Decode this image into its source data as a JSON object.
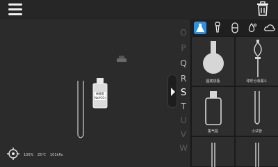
{
  "header": {
    "menu_icon": "hamburger-menu-icon",
    "trash_icon": "trash-icon"
  },
  "letter_rail": {
    "letters": [
      "O",
      "P",
      "Q",
      "R",
      "S",
      "T",
      "U",
      "V",
      "W"
    ],
    "active": "S"
  },
  "bench": {
    "bottle_label_line1": "碳酸氢",
    "bottle_label_line2": "NaHCO₃"
  },
  "panel": {
    "tabs": [
      {
        "name": "flask-tab",
        "icon": "flask-icon",
        "active": true
      },
      {
        "name": "dropper-tab",
        "icon": "dropper-icon",
        "active": false
      },
      {
        "name": "capsule-tab",
        "icon": "capsule-icon",
        "active": false
      },
      {
        "name": "drops-tab",
        "icon": "drops-icon",
        "active": false
      },
      {
        "name": "cloud-tab",
        "icon": "cloud-icon",
        "active": false
      }
    ],
    "items": [
      {
        "label": "圆底烧瓶"
      },
      {
        "label": "球形分液漏斗"
      },
      {
        "label": "集气瓶"
      },
      {
        "label": "小试管"
      }
    ]
  },
  "status": {
    "humidity": "100%",
    "temperature": "25℃",
    "pressure": "101kPa"
  },
  "colors": {
    "accent": "#2f8fe0",
    "background": "#2b2b2b",
    "panel": "#1f1f1f"
  }
}
